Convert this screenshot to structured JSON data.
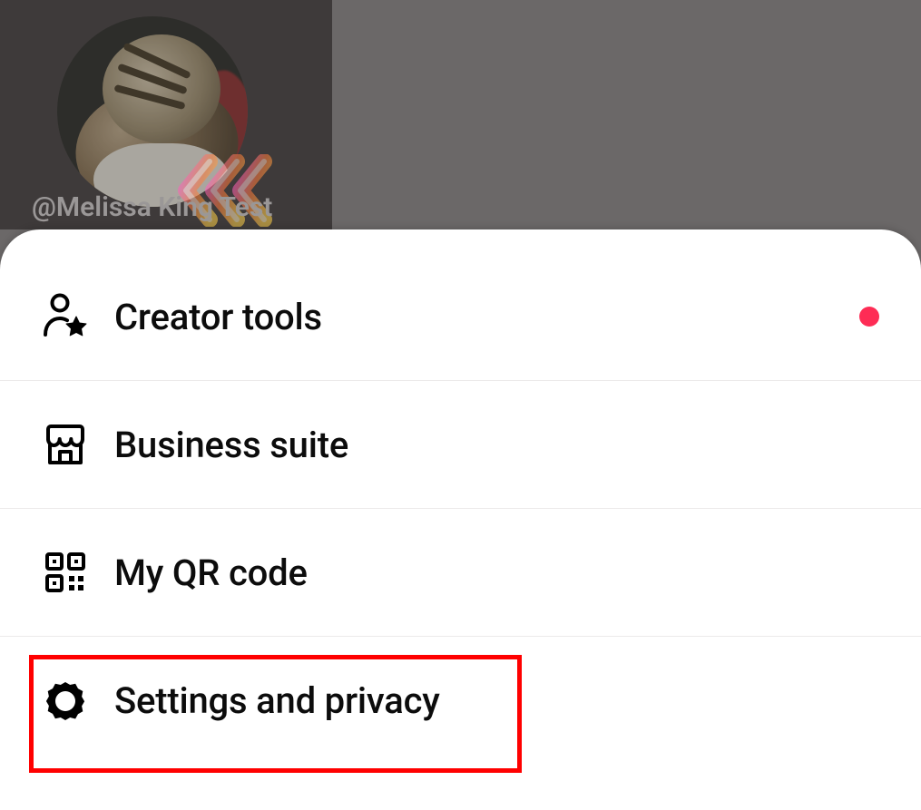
{
  "profile": {
    "username": "@Melissa King Test"
  },
  "menu": {
    "items": [
      {
        "label": "Creator tools",
        "has_notification": true
      },
      {
        "label": "Business suite"
      },
      {
        "label": "My QR code"
      },
      {
        "label": "Settings and privacy"
      }
    ]
  },
  "colors": {
    "notification_dot": "#fe2c55",
    "highlight_border": "#ff0000"
  }
}
